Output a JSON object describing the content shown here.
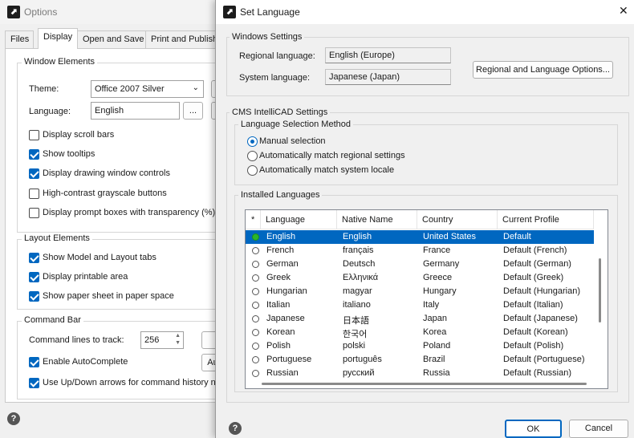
{
  "options": {
    "title": "Options",
    "tabs": [
      "Files",
      "Display",
      "Open and Save",
      "Print and Publish"
    ],
    "window_elements": {
      "label": "Window Elements",
      "theme_label": "Theme:",
      "theme_value": "Office 2007 Silver",
      "language_label": "Language:",
      "language_value": "English",
      "browse_label": "...",
      "checks": [
        {
          "label": "Display scroll bars",
          "checked": false
        },
        {
          "label": "Show tooltips",
          "checked": true
        },
        {
          "label": "Display drawing window controls",
          "checked": true
        },
        {
          "label": "High-contrast grayscale buttons",
          "checked": false
        },
        {
          "label": "Display prompt boxes with transparency (%)",
          "checked": false
        }
      ]
    },
    "layout_elements": {
      "label": "Layout Elements",
      "checks": [
        {
          "label": "Show Model and Layout tabs",
          "checked": true
        },
        {
          "label": "Display printable area",
          "checked": true
        },
        {
          "label": "Show paper sheet in paper space",
          "checked": true
        }
      ]
    },
    "command_bar": {
      "label": "Command Bar",
      "lines_label": "Command lines to track:",
      "lines_value": "256",
      "autocomplete_label": "Enable AutoComplete",
      "autocomplete_checked": true,
      "autocomplete_button": "Au",
      "updown_label": "Use Up/Down arrows for command history na",
      "updown_checked": true
    },
    "help": "?"
  },
  "dialog": {
    "title": "Set Language",
    "close": "✕",
    "windows_settings": {
      "label": "Windows Settings",
      "regional_label": "Regional language:",
      "regional_value": "English (Europe)",
      "system_label": "System language:",
      "system_value": "Japanese (Japan)",
      "options_button": "Regional and Language Options..."
    },
    "cms_settings": {
      "label": "CMS IntelliCAD Settings",
      "method": {
        "label": "Language Selection Method",
        "options": [
          {
            "label": "Manual selection",
            "selected": true
          },
          {
            "label": "Automatically match regional settings",
            "selected": false
          },
          {
            "label": "Automatically match system locale",
            "selected": false
          }
        ]
      },
      "installed": {
        "label": "Installed Languages",
        "columns": [
          "*",
          "Language",
          "Native Name",
          "Country",
          "Current Profile"
        ],
        "rows": [
          {
            "language": "English",
            "native": "English",
            "country": "United States",
            "profile": "Default",
            "active": true,
            "selected": true
          },
          {
            "language": "French",
            "native": "français",
            "country": "France",
            "profile": "Default (French)",
            "active": false,
            "selected": false
          },
          {
            "language": "German",
            "native": "Deutsch",
            "country": "Germany",
            "profile": "Default (German)",
            "active": false,
            "selected": false
          },
          {
            "language": "Greek",
            "native": "Ελληνικά",
            "country": "Greece",
            "profile": "Default (Greek)",
            "active": false,
            "selected": false
          },
          {
            "language": "Hungarian",
            "native": "magyar",
            "country": "Hungary",
            "profile": "Default (Hungarian)",
            "active": false,
            "selected": false
          },
          {
            "language": "Italian",
            "native": "italiano",
            "country": "Italy",
            "profile": "Default (Italian)",
            "active": false,
            "selected": false
          },
          {
            "language": "Japanese",
            "native": "日本語",
            "country": "Japan",
            "profile": "Default (Japanese)",
            "active": false,
            "selected": false
          },
          {
            "language": "Korean",
            "native": "한국어",
            "country": "Korea",
            "profile": "Default (Korean)",
            "active": false,
            "selected": false
          },
          {
            "language": "Polish",
            "native": "polski",
            "country": "Poland",
            "profile": "Default (Polish)",
            "active": false,
            "selected": false
          },
          {
            "language": "Portuguese",
            "native": "português",
            "country": "Brazil",
            "profile": "Default (Portuguese)",
            "active": false,
            "selected": false
          },
          {
            "language": "Russian",
            "native": "русский",
            "country": "Russia",
            "profile": "Default (Russian)",
            "active": false,
            "selected": false
          }
        ]
      }
    },
    "ok": "OK",
    "cancel": "Cancel",
    "help": "?"
  },
  "colors": {
    "accent": "#0067c0",
    "active_dot": "#2bb52b"
  }
}
